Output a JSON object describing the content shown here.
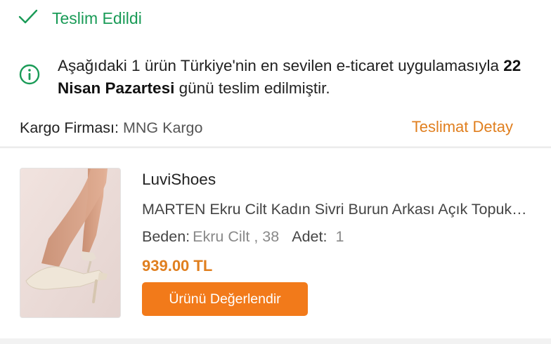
{
  "status": {
    "label": "Teslim Edildi",
    "icon": "check-icon",
    "color": "#1a9b57"
  },
  "notice": {
    "icon": "info-icon",
    "text_before": "Aşağıdaki 1 ürün Türkiye'nin en sevilen e-ticaret uygulamasıyla ",
    "date": "22 Nisan Pazartesi",
    "text_after": " günü teslim edilmiştir."
  },
  "cargo": {
    "label": "Kargo Firması:",
    "value": "MNG Kargo"
  },
  "delivery_detail_link": "Teslimat Detay",
  "product": {
    "image": "product-image",
    "seller": "LuviShoes",
    "name": "MARTEN Ekru Cilt Kadın Sivri Burun Arkası Açık Topuklu Ayakkabı",
    "size_label": "Beden:",
    "size_value": "Ekru Cilt , 38",
    "qty_label": "Adet:",
    "qty_value": "1",
    "price": "939.00 TL",
    "rate_button": "Ürünü Değerlendir"
  },
  "colors": {
    "accent": "#f27a1a",
    "success": "#1a9b57"
  }
}
